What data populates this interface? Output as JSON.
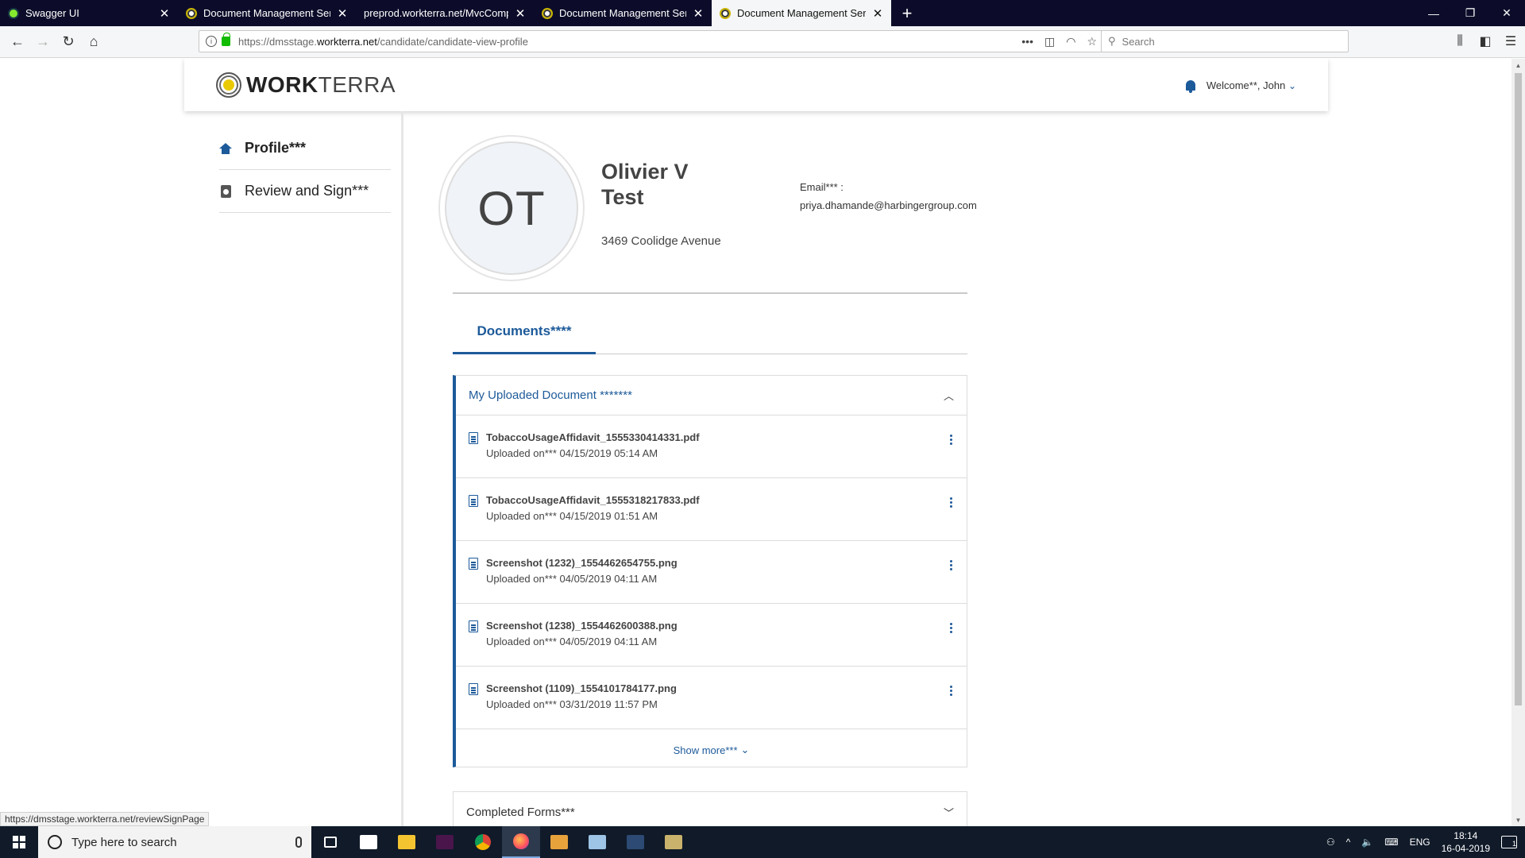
{
  "browser": {
    "tabs": [
      {
        "title": "Swagger UI",
        "favicon": "swagger-icon",
        "active": false
      },
      {
        "title": "Document Management Servic",
        "favicon": "workterra-icon",
        "active": false
      },
      {
        "title": "preprod.workterra.net/MvcCompA",
        "favicon": "none",
        "active": false
      },
      {
        "title": "Document Management Servic",
        "favicon": "workterra-icon",
        "active": false
      },
      {
        "title": "Document Management Servic",
        "favicon": "workterra-icon",
        "active": true
      }
    ],
    "url_prefix": "https://dmsstage.",
    "url_domain": "workterra.net",
    "url_path": "/candidate/candidate-view-profile",
    "search_placeholder": "Search",
    "status_url": "https://dmsstage.workterra.net/reviewSignPage"
  },
  "header": {
    "logo_bold": "WORK",
    "logo_light": "TERRA",
    "welcome": "Welcome**, John"
  },
  "sidebar": {
    "items": [
      {
        "label": "Profile***",
        "icon": "home-icon"
      },
      {
        "label": "Review and Sign***",
        "icon": "clipboard-icon"
      }
    ]
  },
  "profile": {
    "initials": "OT",
    "name_line1": "Olivier V",
    "name_line2": "Test",
    "address": "3469 Coolidge Avenue",
    "email_label": "Email*** :",
    "email": "priya.dhamande@harbingergroup.com"
  },
  "tabs": {
    "documents": "Documents****"
  },
  "uploaded": {
    "title": "My Uploaded Document *******",
    "documents": [
      {
        "name": "TobaccoUsageAffidavit_1555330414331.pdf",
        "uploaded": "Uploaded on*** 04/15/2019 05:14 AM"
      },
      {
        "name": "TobaccoUsageAffidavit_1555318217833.pdf",
        "uploaded": "Uploaded on*** 04/15/2019 01:51 AM"
      },
      {
        "name": "Screenshot (1232)_1554462654755.png",
        "uploaded": "Uploaded on*** 04/05/2019 04:11 AM"
      },
      {
        "name": "Screenshot (1238)_1554462600388.png",
        "uploaded": "Uploaded on*** 04/05/2019 04:11 AM"
      },
      {
        "name": "Screenshot (1109)_1554101784177.png",
        "uploaded": "Uploaded on*** 03/31/2019 11:57 PM"
      }
    ],
    "show_more": "Show more***"
  },
  "completed": {
    "title": "Completed Forms***"
  },
  "taskbar": {
    "search_placeholder": "Type here to search",
    "language": "ENG",
    "time": "18:14",
    "date": "16-04-2019",
    "notifications": "1"
  },
  "colors": {
    "brand_blue": "#1d5a9a",
    "tabbar": "#0c0c2a",
    "taskbar": "#101a29"
  }
}
